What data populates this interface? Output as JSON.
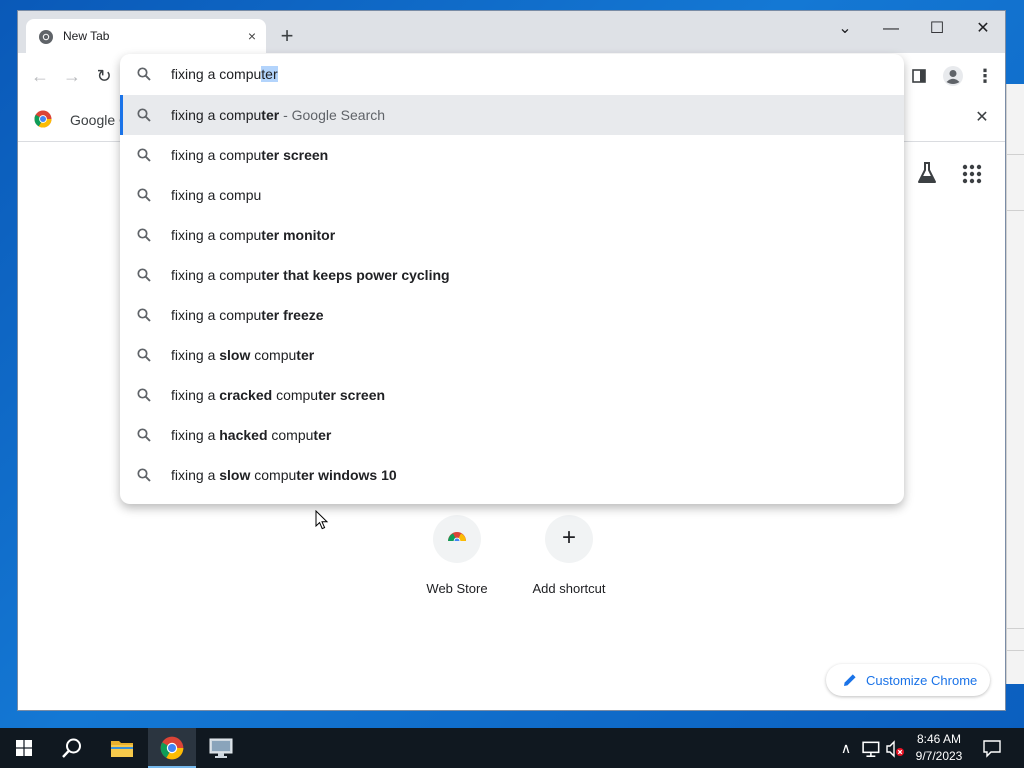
{
  "browser": {
    "tab_title": "New Tab",
    "new_tab_glyph": "+",
    "tab_close_glyph": "×",
    "window_controls": {
      "minimize": "—",
      "maximize": "☐",
      "close": "✕",
      "dropdown": "⌄"
    }
  },
  "toolbar": {
    "back_glyph": "←",
    "forward_glyph": "→",
    "reload_glyph": "↻",
    "menu_glyph": "⋮"
  },
  "omnibox": {
    "typed_prefix": "fixing a compu",
    "autocomplete_selected": "ter",
    "suggestions": [
      {
        "parts": [
          {
            "t": "fixing a compu",
            "b": false
          },
          {
            "t": "ter",
            "b": true
          }
        ],
        "desc": " - Google Search",
        "active": true
      },
      {
        "parts": [
          {
            "t": "fixing a compu",
            "b": false
          },
          {
            "t": "ter screen",
            "b": true
          }
        ]
      },
      {
        "parts": [
          {
            "t": "fixing a compu",
            "b": false
          }
        ]
      },
      {
        "parts": [
          {
            "t": "fixing a compu",
            "b": false
          },
          {
            "t": "ter monitor",
            "b": true
          }
        ]
      },
      {
        "parts": [
          {
            "t": "fixing a compu",
            "b": false
          },
          {
            "t": "ter that keeps power cycling",
            "b": true
          }
        ]
      },
      {
        "parts": [
          {
            "t": "fixing a compu",
            "b": false
          },
          {
            "t": "ter freeze",
            "b": true
          }
        ]
      },
      {
        "parts": [
          {
            "t": "fixing a ",
            "b": false
          },
          {
            "t": "slow",
            "b": true
          },
          {
            "t": " compu",
            "b": false
          },
          {
            "t": "ter",
            "b": true
          }
        ]
      },
      {
        "parts": [
          {
            "t": "fixing a ",
            "b": false
          },
          {
            "t": "cracked",
            "b": true
          },
          {
            "t": " compu",
            "b": false
          },
          {
            "t": "ter screen",
            "b": true
          }
        ]
      },
      {
        "parts": [
          {
            "t": "fixing a ",
            "b": false
          },
          {
            "t": "hacked",
            "b": true
          },
          {
            "t": " compu",
            "b": false
          },
          {
            "t": "ter",
            "b": true
          }
        ]
      },
      {
        "parts": [
          {
            "t": "fixing a ",
            "b": false
          },
          {
            "t": "slow",
            "b": true
          },
          {
            "t": " compu",
            "b": false
          },
          {
            "t": "ter windows 10",
            "b": true
          }
        ]
      }
    ]
  },
  "bookmark_bar": {
    "item_label": "Google C",
    "close_glyph": "✕"
  },
  "ntp": {
    "shortcuts": [
      {
        "label": "Web Store",
        "icon": "web-store-icon"
      },
      {
        "label": "Add shortcut",
        "icon": "plus-icon",
        "glyph": "+"
      }
    ],
    "customize_label": "Customize Chrome"
  },
  "taskbar": {
    "time": "8:46 AM",
    "date": "9/7/2023",
    "tray_up_glyph": "∧"
  },
  "colors": {
    "accent": "#1a73e8",
    "desktop": "#0a66c8",
    "taskbar": "#101820"
  }
}
